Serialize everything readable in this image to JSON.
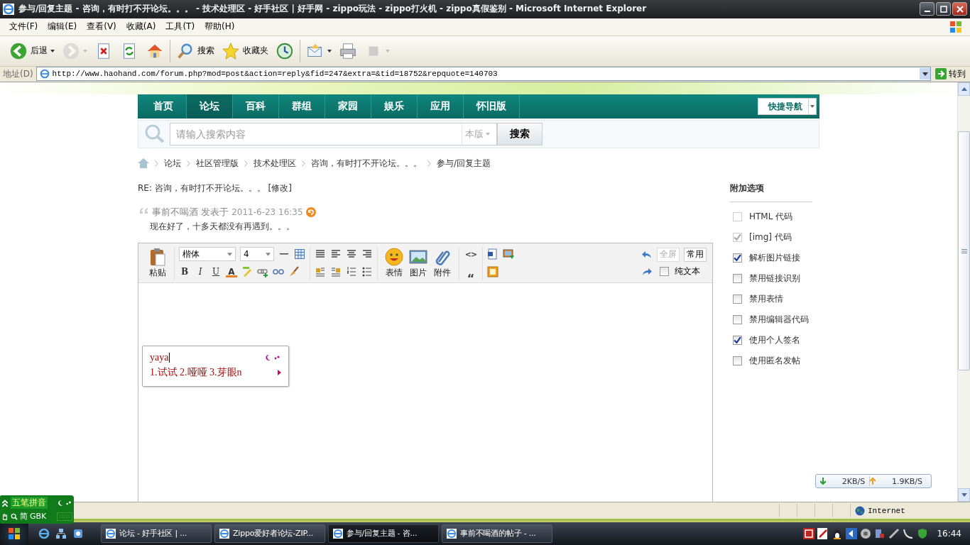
{
  "window": {
    "title": "参与/回复主题 - 咨询，有时打不开论坛。。。 - 技术处理区 - 好手社区 | 好手网 - zippo玩法 - zippo打火机 - zippo真假鉴别 - Microsoft Internet Explorer"
  },
  "menu": [
    "文件(F)",
    "编辑(E)",
    "查看(V)",
    "收藏(A)",
    "工具(T)",
    "帮助(H)"
  ],
  "toolbar": {
    "groups": [
      [
        {
          "kind": "back",
          "label": "后退",
          "dropdown": true,
          "disabled": false
        },
        {
          "kind": "forward",
          "dropdown": true,
          "disabled": true
        },
        {
          "kind": "stop",
          "dropdown": false,
          "disabled": false
        },
        {
          "kind": "refresh",
          "dropdown": false,
          "disabled": false
        },
        {
          "kind": "home",
          "dropdown": false,
          "disabled": false
        }
      ],
      [
        {
          "kind": "search",
          "label": "搜索",
          "dropdown": false,
          "disabled": false
        },
        {
          "kind": "favorites",
          "label": "收藏夹",
          "dropdown": false,
          "disabled": false
        },
        {
          "kind": "history",
          "dropdown": false,
          "disabled": false
        }
      ],
      [
        {
          "kind": "mail",
          "dropdown": true,
          "disabled": false
        },
        {
          "kind": "print",
          "dropdown": false,
          "disabled": false
        },
        {
          "kind": "edit",
          "dropdown": true,
          "disabled": true
        }
      ]
    ]
  },
  "address": {
    "label": "地址(D)",
    "url": "http://www.haohand.com/forum.php?mod=post&action=reply&fid=247&extra=&tid=18752&repquote=140703",
    "go": "转到"
  },
  "nav": {
    "items": [
      {
        "label": "首页",
        "selected": false
      },
      {
        "label": "论坛",
        "selected": true
      },
      {
        "label": "百科",
        "selected": false
      },
      {
        "label": "群组",
        "selected": false
      },
      {
        "label": "家园",
        "selected": false
      },
      {
        "label": "娱乐",
        "selected": false
      },
      {
        "label": "应用",
        "selected": false
      },
      {
        "label": "怀旧版",
        "selected": false
      }
    ],
    "quick_nav": "快捷导航"
  },
  "search": {
    "placeholder": "请输入搜索内容",
    "scope": "本版",
    "button": "搜索"
  },
  "breadcrumb": [
    "论坛",
    "社区管理版",
    "技术处理区",
    "咨询，有时打不开论坛。。。",
    "参与/回复主题"
  ],
  "post": {
    "title": "RE: 咨询，有时打不开论坛。。。",
    "edit_link": "[修改]"
  },
  "quote": {
    "author": "事前不喝酒",
    "posted": "发表于",
    "time": "2011-6-23 16:35",
    "text": "现在好了，十多天都没有再遇到。。。"
  },
  "editor": {
    "paste": "粘贴",
    "font": "楷体",
    "size": "4",
    "format_row1": [
      {
        "kind": "hr"
      },
      {
        "kind": "table"
      }
    ],
    "format_row2": [
      {
        "kind": "bold",
        "label": "B"
      },
      {
        "kind": "italic",
        "label": "I"
      },
      {
        "kind": "underline",
        "label": "U"
      },
      {
        "kind": "color",
        "label": "A"
      },
      {
        "kind": "highlight"
      },
      {
        "kind": "link"
      },
      {
        "kind": "unlink"
      },
      {
        "kind": "brush"
      }
    ],
    "align_row1": [
      {
        "kind": "justify"
      },
      {
        "kind": "align-left"
      },
      {
        "kind": "align-center"
      },
      {
        "kind": "align-right"
      }
    ],
    "align_row2": [
      {
        "kind": "float-left"
      },
      {
        "kind": "float-right"
      },
      {
        "kind": "ordered-list"
      },
      {
        "kind": "bullet-list"
      }
    ],
    "media": [
      {
        "kind": "emoticon",
        "label": "表情"
      },
      {
        "kind": "image",
        "label": "图片"
      },
      {
        "kind": "attachment",
        "label": "附件"
      }
    ],
    "code_row1": [
      {
        "kind": "code",
        "label": "<>"
      }
    ],
    "code_row2": [
      {
        "kind": "quote",
        "label": "“"
      }
    ],
    "insert_row1": [
      {
        "kind": "word"
      },
      {
        "kind": "insert-image"
      }
    ],
    "insert_row2": [
      {
        "kind": "frame"
      }
    ],
    "fullscreen": {
      "label": "全屏",
      "disabled": true
    },
    "common": "常用",
    "plain_text": {
      "label": "纯文本",
      "checked": false
    }
  },
  "ime_popup": {
    "input": "yaya",
    "candidates": "1.试试 2.哑哑 3.芽眼n"
  },
  "options": {
    "title": "附加选项",
    "groups": [
      [
        {
          "label": "HTML 代码",
          "checked": false,
          "disabled": true
        },
        {
          "label": "[img] 代码",
          "checked": true,
          "disabled": true
        },
        {
          "label": "解析图片链接",
          "checked": true,
          "disabled": false
        },
        {
          "label": "禁用链接识别",
          "checked": false,
          "disabled": false
        },
        {
          "label": "禁用表情",
          "checked": false,
          "disabled": false
        },
        {
          "label": "禁用编辑器代码",
          "checked": false,
          "disabled": false
        }
      ],
      [
        {
          "label": "使用个人签名",
          "checked": true,
          "disabled": false
        },
        {
          "label": "使用匿名发帖",
          "checked": false,
          "disabled": false
        }
      ]
    ]
  },
  "speed": {
    "down": "2KB/S",
    "up": "1.9KB/S"
  },
  "status_bar": {
    "zone": "Internet"
  },
  "ime_bar": {
    "name": "五笔拼音",
    "mode": "简",
    "charset": "GBK"
  },
  "taskbar": {
    "tasks": [
      {
        "label": "论坛 - 好手社区 | ...",
        "selected": false
      },
      {
        "label": "Zippo爱好者论坛-ZIP...",
        "selected": false
      },
      {
        "label": "参与/回复主题 - 咨...",
        "selected": true
      },
      {
        "label": "事前不喝酒的帖子 - ...",
        "selected": false
      }
    ],
    "clock": "16:44"
  }
}
